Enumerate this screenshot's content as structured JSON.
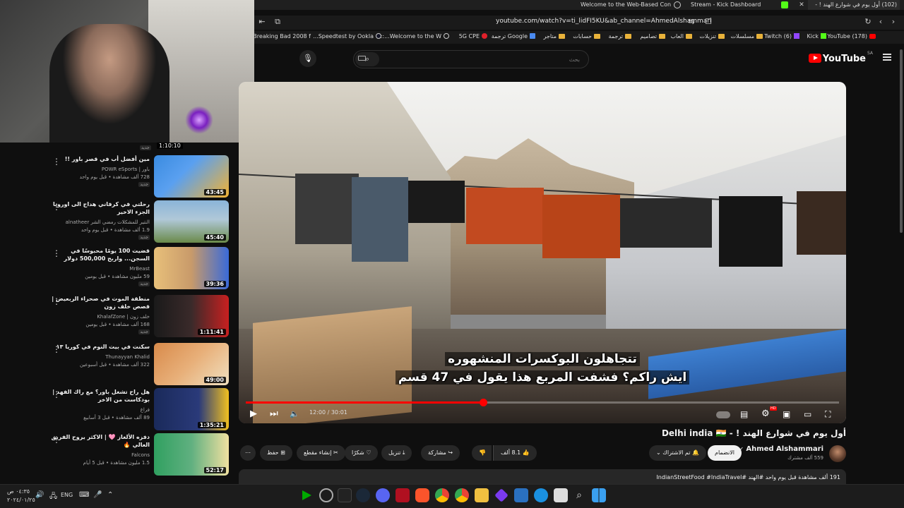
{
  "browser": {
    "tabs": [
      {
        "label": "(102) أول يوم في شوارع الهند ! -",
        "active": true
      },
      {
        "label": "Stream - Kick Dashboard",
        "active": false
      },
      {
        "label": "Welcome to the Web-Based Config::",
        "active": false
      }
    ],
    "url": "youtube.com/watch?v=ti_lidFI5KU&ab_channel=AhmedAlshammari",
    "bookmarks": [
      {
        "label": "(178) YouTube",
        "icon": "youtube-icon"
      },
      {
        "label": "Kick",
        "icon": "kick-icon"
      },
      {
        "label": "Twitch (6)",
        "icon": "twitch-icon"
      },
      {
        "label": "مسلسلات",
        "icon": "folder-icon"
      },
      {
        "label": "تنزيلات",
        "icon": "folder-icon"
      },
      {
        "label": "العاب",
        "icon": "folder-icon"
      },
      {
        "label": "تصاميم",
        "icon": "folder-icon"
      },
      {
        "label": "ترجمة",
        "icon": "folder-icon"
      },
      {
        "label": "حسابات",
        "icon": "folder-icon"
      },
      {
        "label": "متاجر",
        "icon": "folder-icon"
      },
      {
        "label": "Google ترجمة",
        "icon": "translate-icon"
      },
      {
        "label": "5G CPE",
        "icon": "huawei-icon"
      },
      {
        "label": "Welcome to the W...::",
        "icon": "globe-icon"
      },
      {
        "label": "Speedtest by Ookla...",
        "icon": "speedtest-icon"
      },
      {
        "label": "Breaking Bad 2008 f...",
        "icon": "page-icon"
      }
    ]
  },
  "youtube": {
    "logo": "YouTube",
    "region": "SA",
    "search_placeholder": "بحث"
  },
  "sidebar": {
    "top_badge": "جديد",
    "top_duration": "1:10:10",
    "items": [
      {
        "title": "مين أفضل أب في قصر باور !!",
        "channel": "باور | POWR eSports",
        "meta": "728 ألف مشاهدة • قبل يوم واحد",
        "badge": "جديد",
        "duration": "43:45",
        "colors": [
          "#3a8be0",
          "#f2b233"
        ]
      },
      {
        "title": "رحلتي في كرفاني هداج الى اوروبا الجزء الاخير",
        "channel": "النتير للمشكلات رمضي الشر alnatheer",
        "meta": "1.9 ألف مشاهدة • قبل يوم واحد",
        "badge": "جديد",
        "duration": "45:40",
        "colors": [
          "#8ab4d8",
          "#6a8a4a"
        ]
      },
      {
        "title": "قضيت 100 يومًا محبوسًا في السجن... واربح 500,000 دولار",
        "channel": "MrBeast",
        "meta": "59 مليون مشاهدة • قبل يومين",
        "badge": "جديد",
        "duration": "39:36",
        "colors": [
          "#e8c07a",
          "#3a6ad8"
        ]
      },
      {
        "title": "منطقة الموت في صحراء الربعيض | قصص خلف زون",
        "channel": "خلف زون | KhalafZone",
        "meta": "168 ألف مشاهدة • قبل يومين",
        "badge": "جديد",
        "duration": "1:11:41",
        "colors": [
          "#1a1a1a",
          "#c82020"
        ]
      },
      {
        "title": "سكنت في بيت النوم في كوريا ١٣",
        "channel": "Thunayyan Khalid",
        "meta": "322 ألف مشاهدة • قبل أسبوعين",
        "badge": "",
        "duration": "49:00",
        "colors": [
          "#d88a4a",
          "#f0e0c0"
        ]
      },
      {
        "title": "هل راح تشغل باور؟ مع راك الفهد | بودكاست من الاخر",
        "channel": "فراغ",
        "meta": "89 ألف مشاهدة • قبل 3 أسابيع",
        "badge": "",
        "duration": "1:35:21",
        "colors": [
          "#1a2a5a",
          "#f0c020"
        ]
      },
      {
        "title": "دفزه الألغاز 🩷 | الاكثر يروح الفريق العالي 🔥",
        "channel": "Falcons",
        "meta": "1.5 مليون مشاهدة • قبل 5 أيام",
        "badge": "",
        "duration": "52:17",
        "colors": [
          "#30a060",
          "#f0e0a0"
        ]
      }
    ]
  },
  "player": {
    "subtitle_line1": "تتجاهلون البوكسرات المنشهوره",
    "subtitle_line2": "ايش راكم؟ فشفت المربع هذا يقول في 47 قسم",
    "time_current": "12:00",
    "time_total": "30:01",
    "progress": 0.4,
    "settings_badge": "HD"
  },
  "video": {
    "title": "أول يوم في شوارع الهند ! - Delhi india 🇮🇳",
    "channel_name": "Ahmed Alshammari",
    "subscriber_count": "559 ألف مشترك",
    "join_label": "الانضمام",
    "subscribed_label": "تم الاشتراك",
    "like_count": "8.1 ألف",
    "share_label": "مشاركة",
    "download_label": "تنزيل",
    "thanks_label": "شكرًا",
    "clip_label": "إنشاء مقطع",
    "save_label": "حفظ",
    "description": "191 ألف مشاهدة  قبل يوم واحد  #الهند #IndianStreetFood #IndiaTravel"
  },
  "taskbar": {
    "time": "٠٤:٣٥ ص",
    "date": "٢٠٢٤/٠١/٢٥",
    "lang": "ENG"
  }
}
